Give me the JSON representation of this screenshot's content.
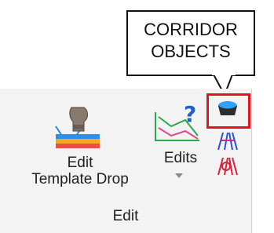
{
  "callout": {
    "line1": "CORRIDOR",
    "line2": "OBJECTS"
  },
  "ribbon": {
    "group_label": "Edit",
    "edit_template_drop": {
      "line1": "Edit",
      "line2": "Template Drop",
      "icon": "template-drop-icon"
    },
    "edits": {
      "label": "Edits",
      "icon": "edits-icon"
    },
    "small_icons": [
      "corridor-objects-icon",
      "corridor-blue-icon",
      "corridor-red-icon"
    ]
  },
  "colors": {
    "highlight": "#e3131b",
    "panel_bg": "#f3f3f3"
  }
}
